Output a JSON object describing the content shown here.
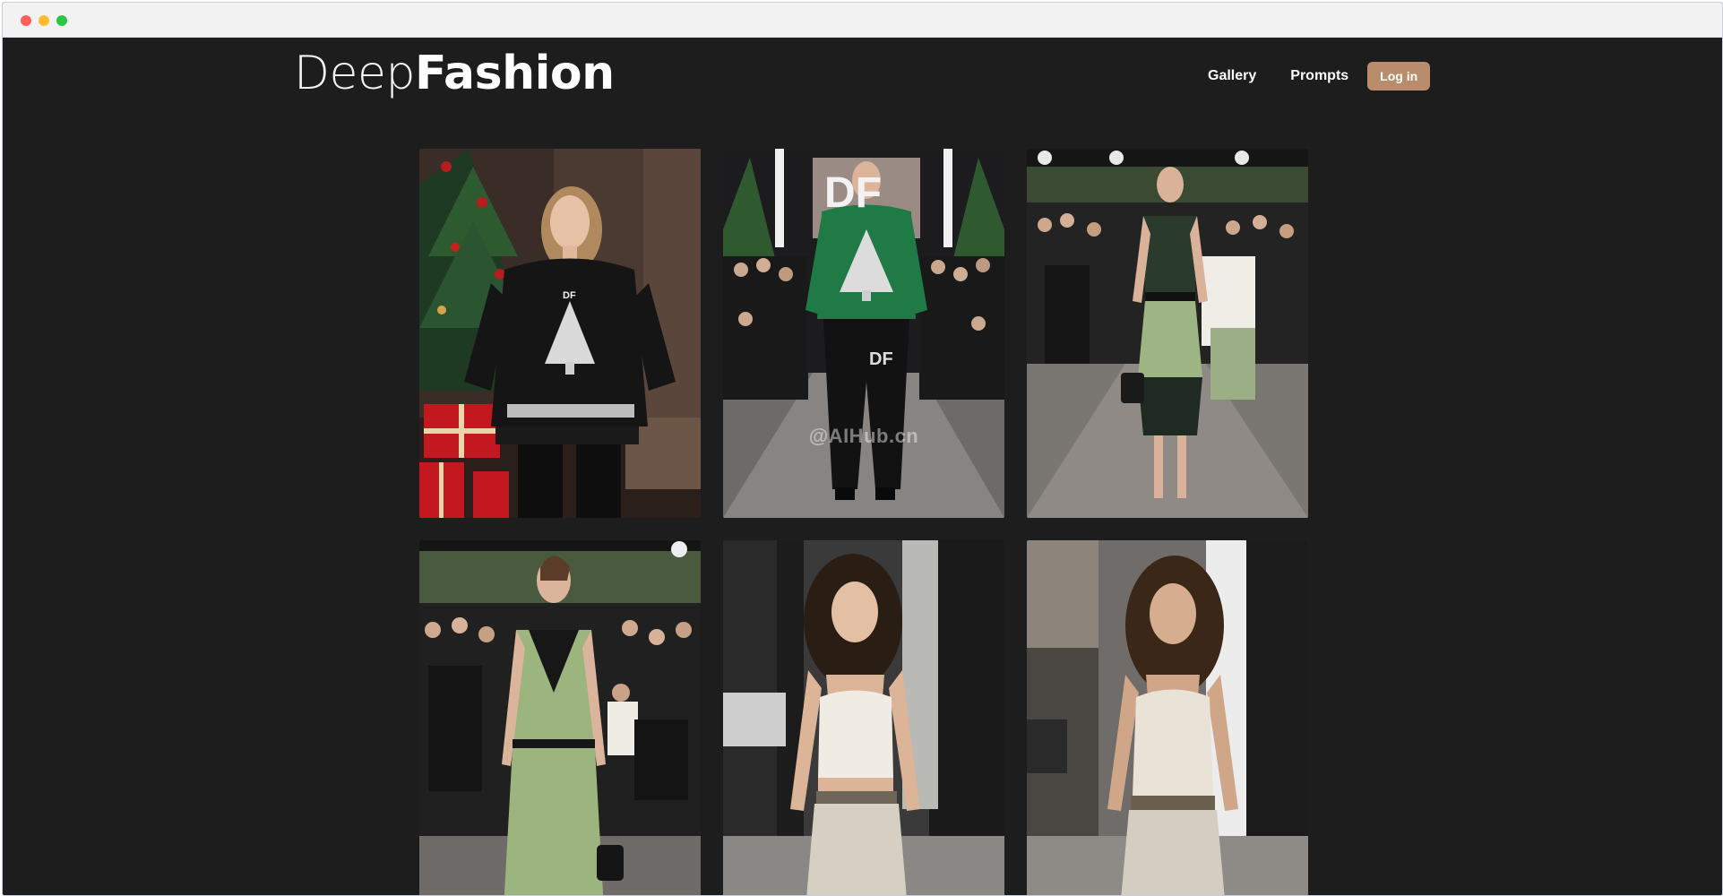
{
  "brand": {
    "light": "Deep",
    "bold": "Fashion"
  },
  "nav": {
    "gallery": "Gallery",
    "prompts": "Prompts",
    "login": "Log in"
  },
  "colors": {
    "background": "#1d1d1d",
    "accent": "#b98d6c"
  },
  "gallery": {
    "tile_2_backdrop_text": "DF",
    "tile_2_pants_text": "DF",
    "tile_2_watermark": "@AIHub.cn",
    "tile_1_sweater_text": "DF"
  }
}
